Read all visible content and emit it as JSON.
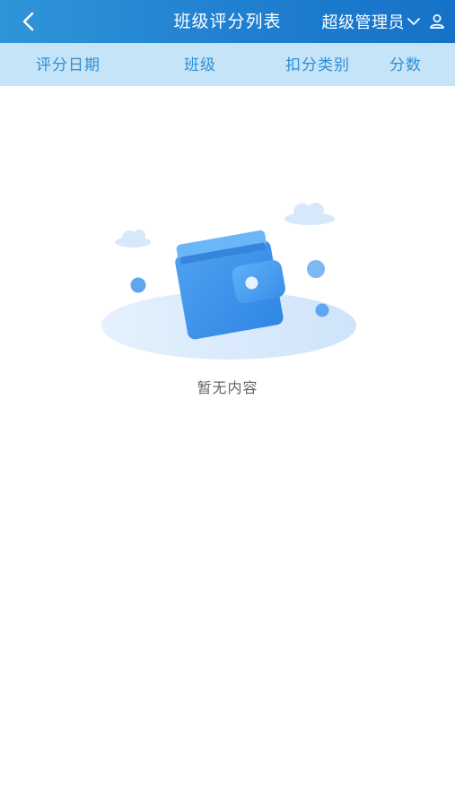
{
  "header": {
    "title": "班级评分列表",
    "user_label": "超级管理员",
    "back_icon": "chevron-left-icon",
    "dropdown_icon": "chevron-down-icon",
    "user_icon": "user-icon"
  },
  "table_header": {
    "columns": [
      "评分日期",
      "班级",
      "扣分类别",
      "分数"
    ]
  },
  "empty_state": {
    "text": "暂无内容",
    "illustration": "wallet-icon"
  },
  "colors": {
    "header_start": "#2f95d9",
    "header_end": "#1672c8",
    "table_header_bg": "#c6e4f7",
    "column_text": "#2f8ed4",
    "empty_text": "#666666"
  }
}
